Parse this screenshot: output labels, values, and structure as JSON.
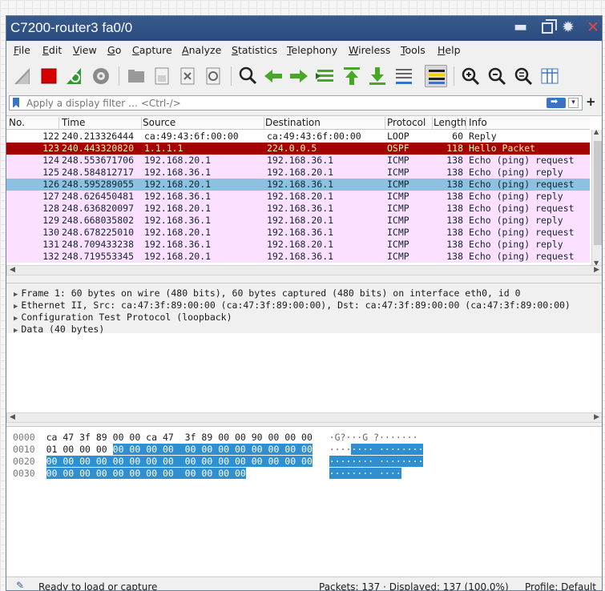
{
  "window": {
    "title": "C7200-router3 fa0/0",
    "controls": [
      "minimize-icon",
      "restore-icon",
      "gear-icon",
      "close-icon"
    ]
  },
  "menu": [
    "File",
    "Edit",
    "View",
    "Go",
    "Capture",
    "Analyze",
    "Statistics",
    "Telephony",
    "Wireless",
    "Tools",
    "Help"
  ],
  "toolbar_icons": [
    "shark-fin-start-icon",
    "stop-capture-icon",
    "restart-capture-icon",
    "capture-options-icon",
    "open-file-icon",
    "save-file-icon",
    "close-file-icon",
    "reload-file-icon",
    "find-packet-icon",
    "go-back-icon",
    "go-forward-icon",
    "go-to-packet-icon",
    "go-first-packet-icon",
    "go-last-packet-icon",
    "auto-scroll-icon",
    "colorize-icon",
    "zoom-in-icon",
    "zoom-out-icon",
    "zoom-reset-icon",
    "resize-columns-icon"
  ],
  "filter": {
    "placeholder": "Apply a display filter … <Ctrl-/>",
    "dropdown": "▾",
    "add": "+"
  },
  "columns": {
    "no": "No.",
    "time": "Time",
    "source": "Source",
    "destination": "Destination",
    "protocol": "Protocol",
    "length": "Length",
    "info": "Info"
  },
  "packets": [
    {
      "no": "122",
      "time": "240.213326444",
      "src": "ca:49:43:6f:00:00",
      "dst": "ca:49:43:6f:00:00",
      "proto": "LOOP",
      "len": "60",
      "info": "Reply",
      "bg": "#ffffff",
      "fg": "#1a1a1a"
    },
    {
      "no": "123",
      "time": "240.443320820",
      "src": "1.1.1.1",
      "dst": "224.0.0.5",
      "proto": "OSPF",
      "len": "118",
      "info": "Hello Packet",
      "bg": "#a40000",
      "fg": "#fffc9c"
    },
    {
      "no": "124",
      "time": "248.553671706",
      "src": "192.168.20.1",
      "dst": "192.168.36.1",
      "proto": "ICMP",
      "len": "138",
      "info": "Echo (ping) request",
      "bg": "#fce0ff",
      "fg": "#12272e"
    },
    {
      "no": "125",
      "time": "248.584812717",
      "src": "192.168.36.1",
      "dst": "192.168.20.1",
      "proto": "ICMP",
      "len": "138",
      "info": "Echo (ping) reply",
      "bg": "#fce0ff",
      "fg": "#12272e"
    },
    {
      "no": "126",
      "time": "248.595289055",
      "src": "192.168.20.1",
      "dst": "192.168.36.1",
      "proto": "ICMP",
      "len": "138",
      "info": "Echo (ping) request",
      "bg": "#8dc1e2",
      "fg": "#12272e"
    },
    {
      "no": "127",
      "time": "248.626450481",
      "src": "192.168.36.1",
      "dst": "192.168.20.1",
      "proto": "ICMP",
      "len": "138",
      "info": "Echo (ping) reply",
      "bg": "#fce0ff",
      "fg": "#12272e"
    },
    {
      "no": "128",
      "time": "248.636820097",
      "src": "192.168.20.1",
      "dst": "192.168.36.1",
      "proto": "ICMP",
      "len": "138",
      "info": "Echo (ping) request",
      "bg": "#fce0ff",
      "fg": "#12272e"
    },
    {
      "no": "129",
      "time": "248.668035802",
      "src": "192.168.36.1",
      "dst": "192.168.20.1",
      "proto": "ICMP",
      "len": "138",
      "info": "Echo (ping) reply",
      "bg": "#fce0ff",
      "fg": "#12272e"
    },
    {
      "no": "130",
      "time": "248.678225010",
      "src": "192.168.20.1",
      "dst": "192.168.36.1",
      "proto": "ICMP",
      "len": "138",
      "info": "Echo (ping) request",
      "bg": "#fce0ff",
      "fg": "#12272e"
    },
    {
      "no": "131",
      "time": "248.709433238",
      "src": "192.168.36.1",
      "dst": "192.168.20.1",
      "proto": "ICMP",
      "len": "138",
      "info": "Echo (ping) reply",
      "bg": "#fce0ff",
      "fg": "#12272e"
    },
    {
      "no": "132",
      "time": "248.719553345",
      "src": "192.168.20.1",
      "dst": "192.168.36.1",
      "proto": "ICMP",
      "len": "138",
      "info": "Echo (ping) request",
      "bg": "#fce0ff",
      "fg": "#12272e"
    }
  ],
  "details": [
    "Frame 1: 60 bytes on wire (480 bits), 60 bytes captured (480 bits) on interface eth0, id 0",
    "Ethernet II, Src: ca:47:3f:89:00:00 (ca:47:3f:89:00:00), Dst: ca:47:3f:89:00:00 (ca:47:3f:89:00:00)",
    "Configuration Test Protocol (loopback)",
    "Data (40 bytes)"
  ],
  "bytes": [
    {
      "offset": "0000",
      "plain": "ca 47 3f 89 00 00 ca 47  3f 89 00 00 90 00 00 00",
      "hl": "",
      "ascii_plain": "·G?···G ?·······",
      "ascii_hl": ""
    },
    {
      "offset": "0010",
      "plain": "01 00 00 00 ",
      "hl": "00 00 00 00  00 00 00 00 00 00 00 00",
      "ascii_plain": "····",
      "ascii_hl": "···· ········"
    },
    {
      "offset": "0020",
      "plain": "",
      "hl": "00 00 00 00 00 00 00 00  00 00 00 00 00 00 00 00",
      "ascii_plain": "",
      "ascii_hl": "········ ········"
    },
    {
      "offset": "0030",
      "plain": "",
      "hl": "00 00 00 00 00 00 00 00  00 00 00 00",
      "ascii_plain": "",
      "ascii_hl": "········ ····"
    }
  ],
  "status": {
    "left": "Ready to load or capture",
    "packets": "Packets: 137 · Displayed: 137 (100.0%)",
    "profile": "Profile: Default"
  }
}
